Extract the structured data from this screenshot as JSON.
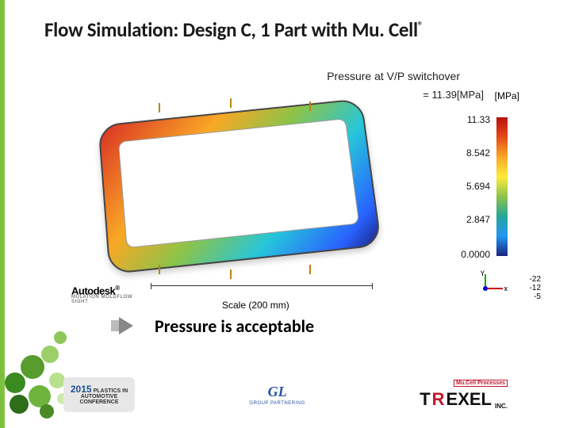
{
  "title": "Flow Simulation: Design C, 1 Part with Mu. Cell",
  "registered": "®",
  "chart": {
    "title": "Pressure at V/P switchover",
    "subtitle": "= 11.39[MPa]",
    "unit": "[MPa]",
    "ticks": [
      "11.33",
      "8.542",
      "5.694",
      "2.847",
      "0.0000"
    ]
  },
  "chart_data": {
    "type": "heatmap",
    "title": "Pressure at V/P switchover",
    "quantity": "Pressure",
    "unit": "MPa",
    "value_at_switchover": 11.39,
    "colorbar": {
      "min": 0.0,
      "max": 11.33,
      "ticks": [
        11.33,
        8.542,
        5.694,
        2.847,
        0.0
      ],
      "colormap": "rainbow (blue=low, red=high)"
    },
    "scale_bar_mm": 200,
    "coordinate_readout": {
      "values": [
        -22,
        -12,
        -5
      ]
    }
  },
  "scale_label": "Scale (200 mm)",
  "autodesk": {
    "name": "Autodesk",
    "sub": "MULATION MOLDFLOW",
    "sub2": "SIGHT"
  },
  "axes": {
    "y": "Y",
    "x": "x"
  },
  "coord_nums": [
    "-22",
    "-12",
    "-5"
  ],
  "conclusion": "Pressure is acceptable",
  "logos": {
    "conf_year": "2015",
    "conf_l1": "PLASTICS IN",
    "conf_l2": "AUTOMOTIVE",
    "conf_l3": "CONFERENCE",
    "gl": "GL",
    "gl_sub": "GROUP PARTNERING",
    "trexel_t": "T",
    "trexel_r": "R",
    "trexel_rest": "EXEL",
    "trexel_tag": "Mu.Cell Processes",
    "trexel_inc": "INC."
  }
}
